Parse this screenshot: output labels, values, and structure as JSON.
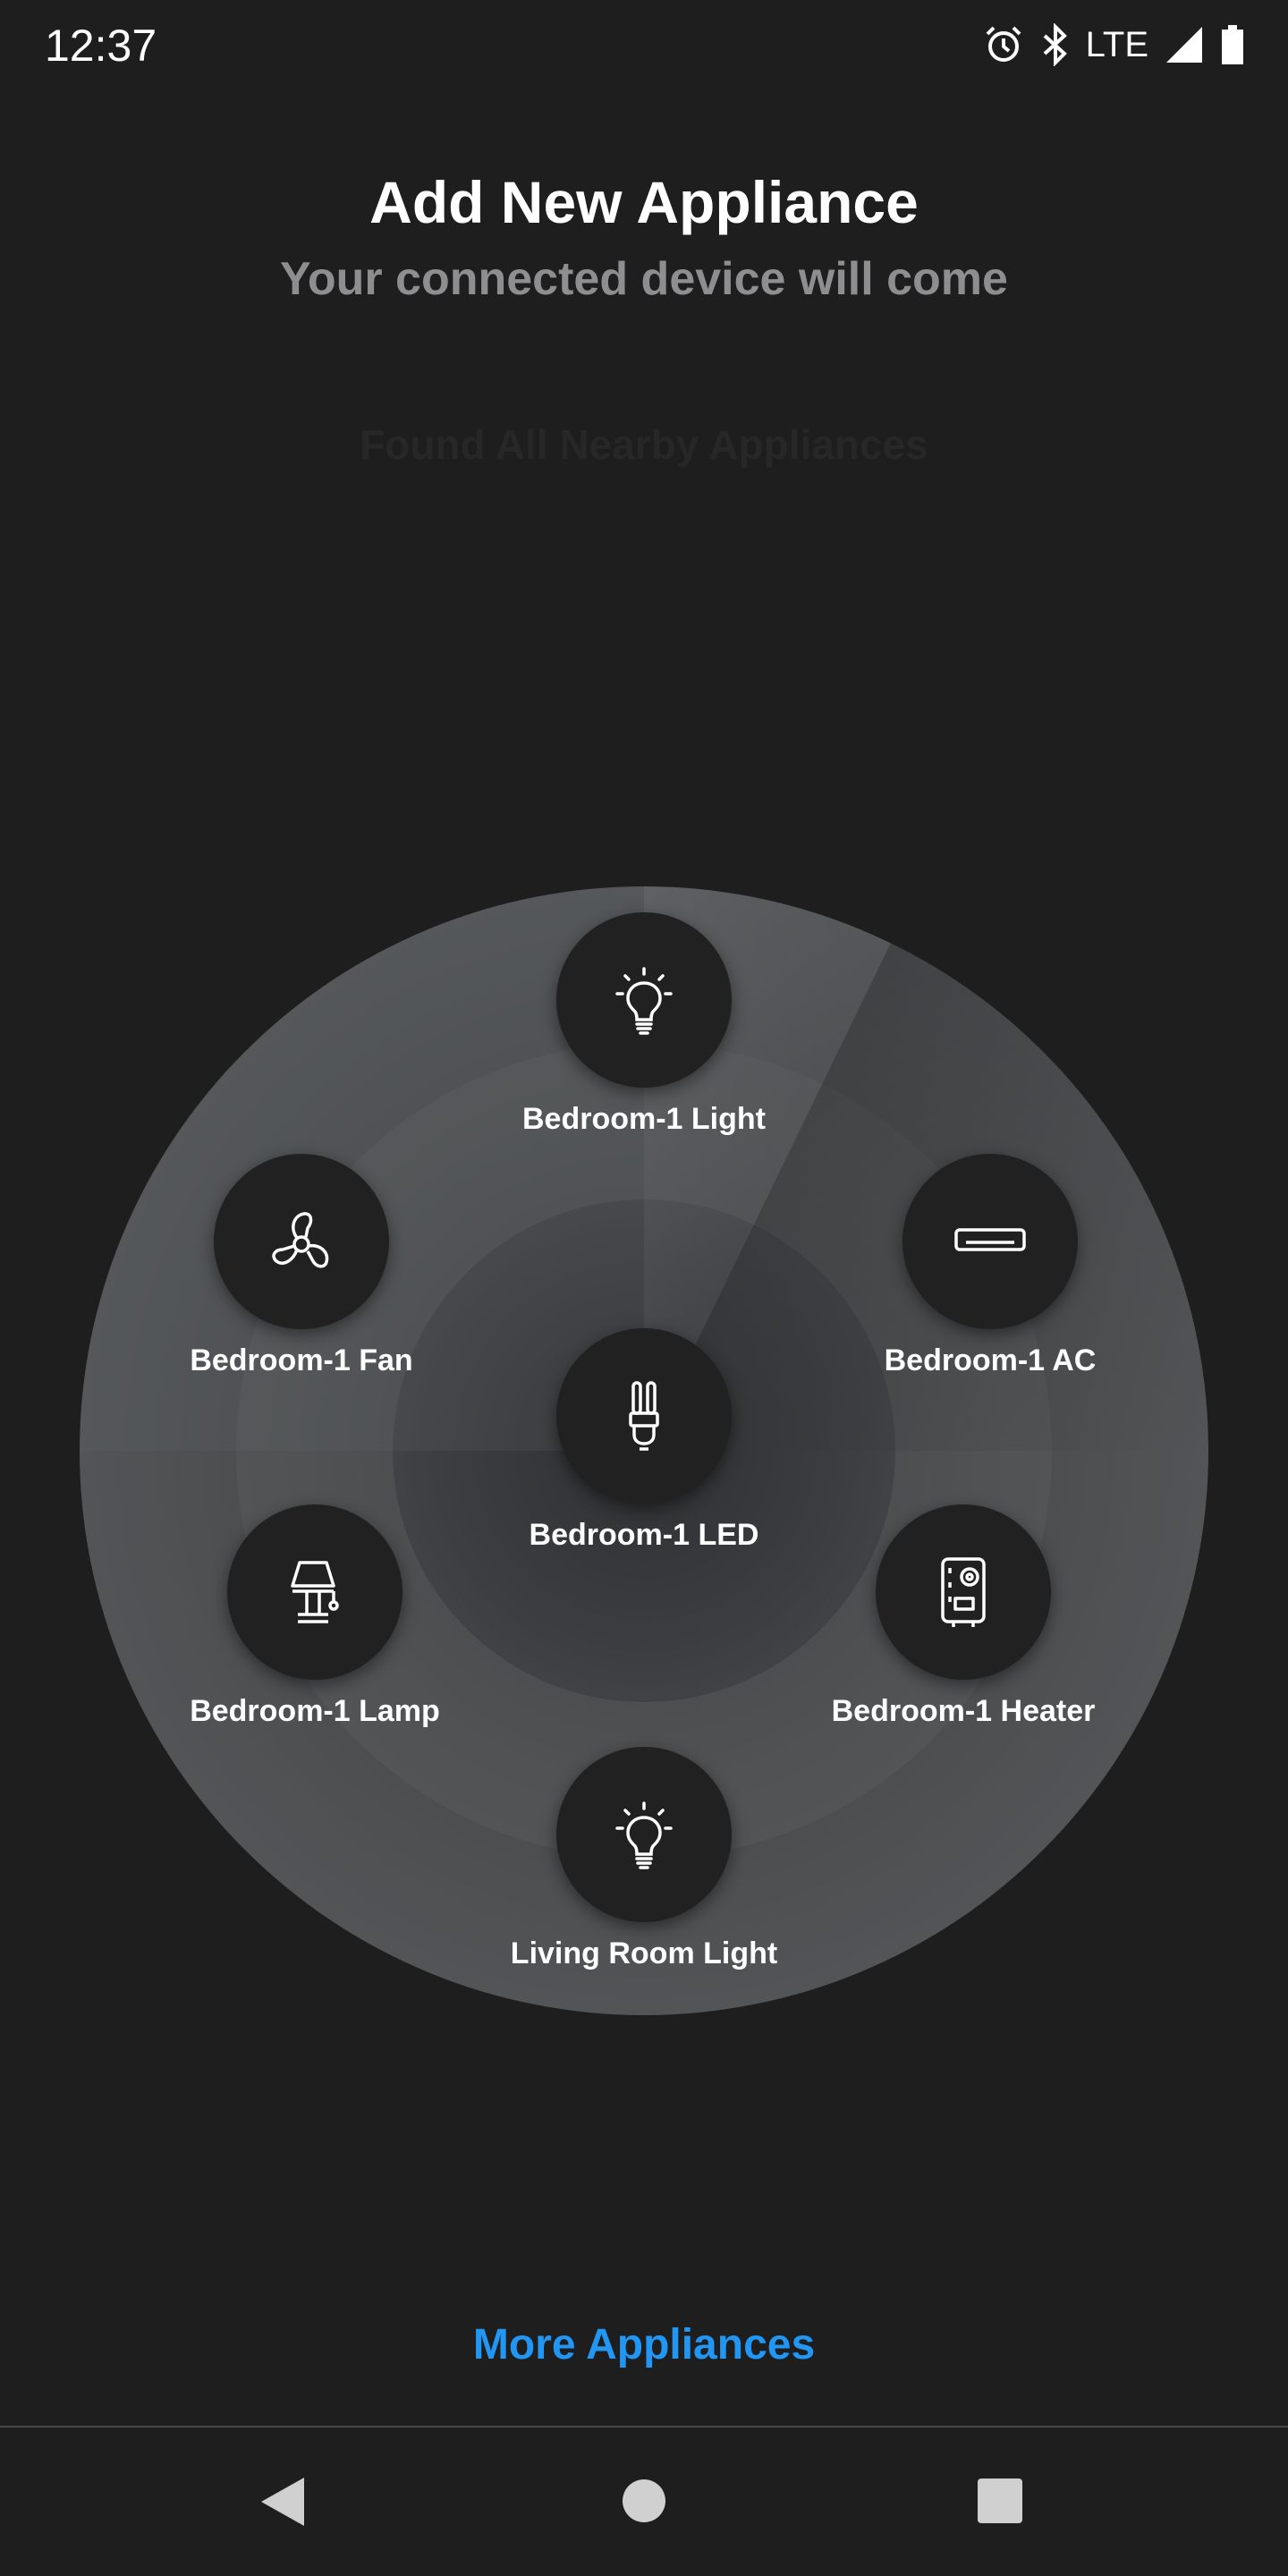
{
  "status_bar": {
    "time": "12:37",
    "network": "LTE",
    "icons": [
      "alarm-icon",
      "bluetooth-icon",
      "signal-icon",
      "battery-icon"
    ]
  },
  "header": {
    "title": "Add New Appliance",
    "subtitle": "Your connected device will come",
    "found_text": "Found All Nearby Appliances"
  },
  "devices": [
    {
      "label": "Bedroom-1 Light",
      "icon": "bulb-icon"
    },
    {
      "label": "Bedroom-1 Fan",
      "icon": "fan-icon"
    },
    {
      "label": "Bedroom-1 AC",
      "icon": "ac-icon"
    },
    {
      "label": "Bedroom-1 LED",
      "icon": "led-icon"
    },
    {
      "label": "Bedroom-1 Lamp",
      "icon": "lamp-icon"
    },
    {
      "label": "Bedroom-1 Heater",
      "icon": "heater-icon"
    },
    {
      "label": "Living Room Light",
      "icon": "bulb-icon"
    }
  ],
  "more_label": "More Appliances",
  "nav": {
    "back": "back-icon",
    "home": "home-icon",
    "recents": "recents-icon"
  },
  "colors": {
    "background": "#1e1e1f",
    "accent": "#2196f3",
    "subtitle": "#8e8e90"
  }
}
